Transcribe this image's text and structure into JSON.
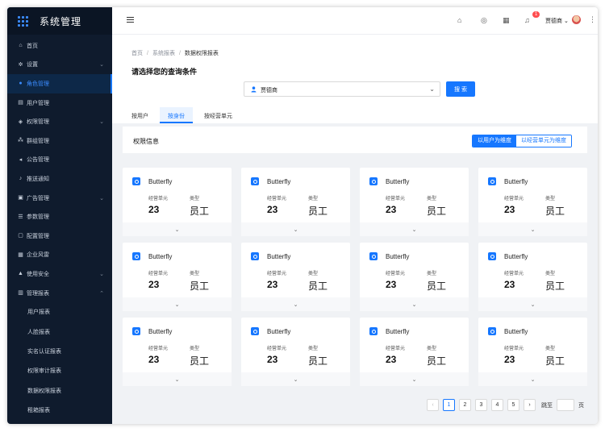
{
  "app": {
    "title": "系统管理"
  },
  "sidebar": {
    "items": [
      {
        "label": "首页",
        "icon": "home-icon",
        "chevron": false
      },
      {
        "label": "设置",
        "icon": "gear-icon",
        "chevron": true
      },
      {
        "label": "角色管理",
        "icon": "user-circle-icon",
        "chevron": false,
        "active": true
      },
      {
        "label": "用户管理",
        "icon": "user-card-icon",
        "chevron": false
      },
      {
        "label": "权限管理",
        "icon": "shield-icon",
        "chevron": true
      },
      {
        "label": "群组管理",
        "icon": "group-icon",
        "chevron": false
      },
      {
        "label": "公告管理",
        "icon": "megaphone-icon",
        "chevron": false
      },
      {
        "label": "推送通知",
        "icon": "bell-icon",
        "chevron": false
      },
      {
        "label": "广告管理",
        "icon": "image-icon",
        "chevron": true
      },
      {
        "label": "参数管理",
        "icon": "list-icon",
        "chevron": false
      },
      {
        "label": "配置管理",
        "icon": "config-icon",
        "chevron": false
      },
      {
        "label": "企业风雷",
        "icon": "grid-icon",
        "chevron": false
      },
      {
        "label": "使用安全",
        "icon": "lock-icon",
        "chevron": true
      },
      {
        "label": "管理报表",
        "icon": "report-icon",
        "chevron": true,
        "expanded": true
      }
    ],
    "subitems": [
      "用户报表",
      "人脸报表",
      "实名认证报表",
      "权限审计报表",
      "数据权限报表",
      "租箱报表"
    ]
  },
  "header": {
    "notification_count": "1",
    "username": "贾德商"
  },
  "breadcrumb": [
    "首页",
    "系统报表",
    "数据权限报表"
  ],
  "query": {
    "title": "请选择您的查询条件",
    "select_value": "贾德商",
    "search_label": "搜 索"
  },
  "tabs": [
    "按用户",
    "按身份",
    "按经营单元"
  ],
  "panel": {
    "title": "权限信息",
    "toggle_on": "以用户为维度",
    "toggle_off": "以经营单元为维度"
  },
  "cards": [
    {
      "name": "Butterfly",
      "label1": "经营单元",
      "label2": "类型",
      "value1": "23",
      "value2": "员工"
    },
    {
      "name": "Butterfly",
      "label1": "经营单元",
      "label2": "类型",
      "value1": "23",
      "value2": "员工"
    },
    {
      "name": "Butterfly",
      "label1": "经营单元",
      "label2": "类型",
      "value1": "23",
      "value2": "员工"
    },
    {
      "name": "Butterfly",
      "label1": "经营单元",
      "label2": "类型",
      "value1": "23",
      "value2": "员工"
    },
    {
      "name": "Butterfly",
      "label1": "经营单元",
      "label2": "类型",
      "value1": "23",
      "value2": "员工"
    },
    {
      "name": "Butterfly",
      "label1": "经营单元",
      "label2": "类型",
      "value1": "23",
      "value2": "员工"
    },
    {
      "name": "Butterfly",
      "label1": "经营单元",
      "label2": "类型",
      "value1": "23",
      "value2": "员工"
    },
    {
      "name": "Butterfly",
      "label1": "经营单元",
      "label2": "类型",
      "value1": "23",
      "value2": "员工"
    },
    {
      "name": "Butterfly",
      "label1": "经营单元",
      "label2": "类型",
      "value1": "23",
      "value2": "员工"
    },
    {
      "name": "Butterfly",
      "label1": "经营单元",
      "label2": "类型",
      "value1": "23",
      "value2": "员工"
    },
    {
      "name": "Butterfly",
      "label1": "经营单元",
      "label2": "类型",
      "value1": "23",
      "value2": "员工"
    },
    {
      "name": "Butterfly",
      "label1": "经营单元",
      "label2": "类型",
      "value1": "23",
      "value2": "员工"
    }
  ],
  "pagination": {
    "pages": [
      "1",
      "2",
      "3",
      "4",
      "5"
    ],
    "current": "1",
    "goto_label": "跳至",
    "page_unit": "页"
  },
  "colors": {
    "accent": "#1677ff",
    "sidebar_bg": "#0f1b2d"
  }
}
